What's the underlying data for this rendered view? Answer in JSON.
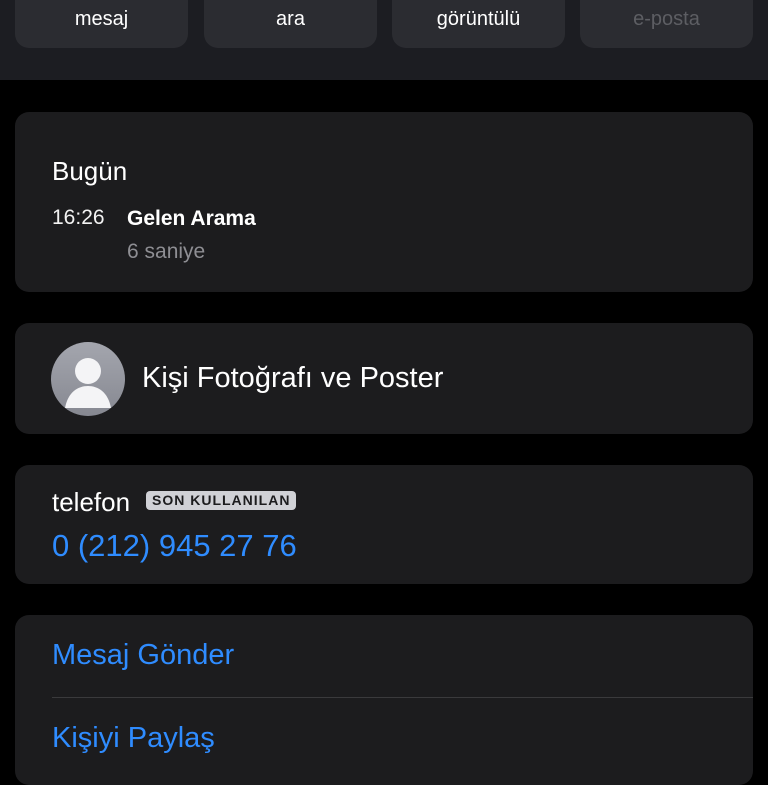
{
  "actions": [
    {
      "label": "mesaj"
    },
    {
      "label": "ara"
    },
    {
      "label": "görüntülü"
    },
    {
      "label": "e-posta"
    }
  ],
  "history": {
    "title": "Bugün",
    "time": "16:26",
    "type": "Gelen Arama",
    "duration": "6 saniye"
  },
  "contact_photo": {
    "label": "Kişi Fotoğrafı ve Poster"
  },
  "phone": {
    "label": "telefon",
    "badge": "SON KULLANILAN",
    "number": "0 (212) 945 27 76"
  },
  "links": {
    "send_message": "Mesaj Gönder",
    "share_contact": "Kişiyi Paylaş"
  },
  "colors": {
    "accent": "#2f8cff",
    "background": "#000000",
    "card": "#1c1c1e"
  }
}
